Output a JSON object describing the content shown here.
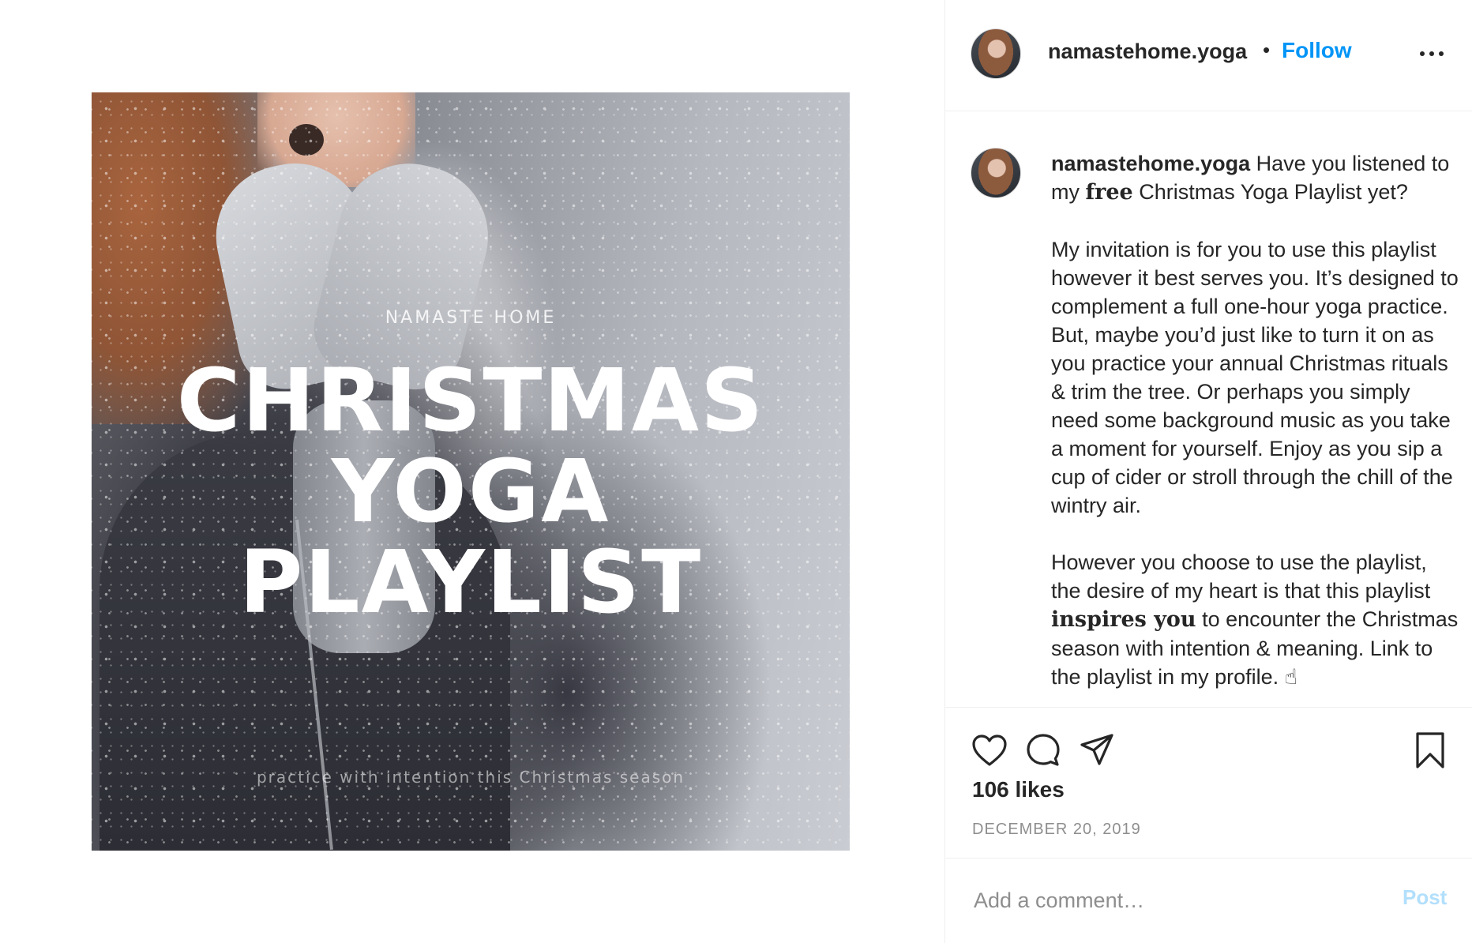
{
  "post_image": {
    "brand_text": "NAMASTE HOME",
    "title_line1": "CHRISTMAS",
    "title_line2": "YOGA",
    "title_line3": "PLAYLIST",
    "tagline": "practice with intention this Christmas season"
  },
  "header": {
    "username": "namastehome.yoga",
    "separator": "•",
    "follow_label": "Follow",
    "more_icon": "more-options-icon"
  },
  "caption": {
    "username": "namastehome.yoga",
    "line1_pre": " Have you listened to my ",
    "line1_emph": "free",
    "line1_post": " Christmas Yoga Playlist yet?",
    "para2": "My invitation is for you to use this playlist however it best serves you. It’s designed to complement a full one-hour yoga practice. But, maybe you’d just like to turn it on as you practice your annual Christmas rituals & trim the tree. Or perhaps you simply need some background music as you take a moment for yourself. Enjoy as you sip a cup of cider or stroll through the chill of the wintry air.",
    "para3_pre": "However you choose to use the playlist, the desire of my heart is that this playlist ",
    "para3_emph": "inspires you",
    "para3_post": " to encounter the Christmas season with intention & meaning. Link to the playlist in my profile. ☝"
  },
  "actions": {
    "icons": [
      "heart-icon",
      "comment-icon",
      "share-icon",
      "bookmark-icon"
    ],
    "likes": "106 likes",
    "date": "DECEMBER 20, 2019"
  },
  "comment_bar": {
    "placeholder": "Add a comment…",
    "post_label": "Post"
  },
  "colors": {
    "accent": "#0095f6",
    "post_disabled": "#b2dffc",
    "text": "#262626",
    "muted": "#8e8e8e",
    "divider": "#efefef"
  }
}
